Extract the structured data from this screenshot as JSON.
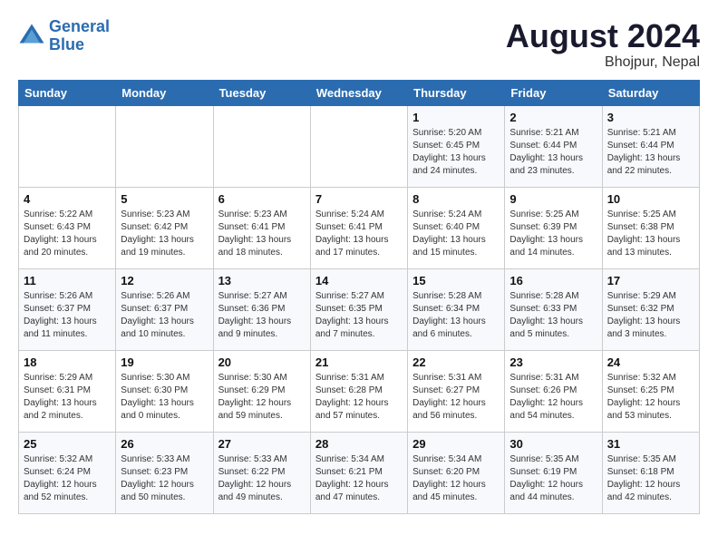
{
  "header": {
    "logo_line1": "General",
    "logo_line2": "Blue",
    "month_year": "August 2024",
    "location": "Bhojpur, Nepal"
  },
  "weekdays": [
    "Sunday",
    "Monday",
    "Tuesday",
    "Wednesday",
    "Thursday",
    "Friday",
    "Saturday"
  ],
  "weeks": [
    [
      {
        "day": "",
        "info": ""
      },
      {
        "day": "",
        "info": ""
      },
      {
        "day": "",
        "info": ""
      },
      {
        "day": "",
        "info": ""
      },
      {
        "day": "1",
        "info": "Sunrise: 5:20 AM\nSunset: 6:45 PM\nDaylight: 13 hours\nand 24 minutes."
      },
      {
        "day": "2",
        "info": "Sunrise: 5:21 AM\nSunset: 6:44 PM\nDaylight: 13 hours\nand 23 minutes."
      },
      {
        "day": "3",
        "info": "Sunrise: 5:21 AM\nSunset: 6:44 PM\nDaylight: 13 hours\nand 22 minutes."
      }
    ],
    [
      {
        "day": "4",
        "info": "Sunrise: 5:22 AM\nSunset: 6:43 PM\nDaylight: 13 hours\nand 20 minutes."
      },
      {
        "day": "5",
        "info": "Sunrise: 5:23 AM\nSunset: 6:42 PM\nDaylight: 13 hours\nand 19 minutes."
      },
      {
        "day": "6",
        "info": "Sunrise: 5:23 AM\nSunset: 6:41 PM\nDaylight: 13 hours\nand 18 minutes."
      },
      {
        "day": "7",
        "info": "Sunrise: 5:24 AM\nSunset: 6:41 PM\nDaylight: 13 hours\nand 17 minutes."
      },
      {
        "day": "8",
        "info": "Sunrise: 5:24 AM\nSunset: 6:40 PM\nDaylight: 13 hours\nand 15 minutes."
      },
      {
        "day": "9",
        "info": "Sunrise: 5:25 AM\nSunset: 6:39 PM\nDaylight: 13 hours\nand 14 minutes."
      },
      {
        "day": "10",
        "info": "Sunrise: 5:25 AM\nSunset: 6:38 PM\nDaylight: 13 hours\nand 13 minutes."
      }
    ],
    [
      {
        "day": "11",
        "info": "Sunrise: 5:26 AM\nSunset: 6:37 PM\nDaylight: 13 hours\nand 11 minutes."
      },
      {
        "day": "12",
        "info": "Sunrise: 5:26 AM\nSunset: 6:37 PM\nDaylight: 13 hours\nand 10 minutes."
      },
      {
        "day": "13",
        "info": "Sunrise: 5:27 AM\nSunset: 6:36 PM\nDaylight: 13 hours\nand 9 minutes."
      },
      {
        "day": "14",
        "info": "Sunrise: 5:27 AM\nSunset: 6:35 PM\nDaylight: 13 hours\nand 7 minutes."
      },
      {
        "day": "15",
        "info": "Sunrise: 5:28 AM\nSunset: 6:34 PM\nDaylight: 13 hours\nand 6 minutes."
      },
      {
        "day": "16",
        "info": "Sunrise: 5:28 AM\nSunset: 6:33 PM\nDaylight: 13 hours\nand 5 minutes."
      },
      {
        "day": "17",
        "info": "Sunrise: 5:29 AM\nSunset: 6:32 PM\nDaylight: 13 hours\nand 3 minutes."
      }
    ],
    [
      {
        "day": "18",
        "info": "Sunrise: 5:29 AM\nSunset: 6:31 PM\nDaylight: 13 hours\nand 2 minutes."
      },
      {
        "day": "19",
        "info": "Sunrise: 5:30 AM\nSunset: 6:30 PM\nDaylight: 13 hours\nand 0 minutes."
      },
      {
        "day": "20",
        "info": "Sunrise: 5:30 AM\nSunset: 6:29 PM\nDaylight: 12 hours\nand 59 minutes."
      },
      {
        "day": "21",
        "info": "Sunrise: 5:31 AM\nSunset: 6:28 PM\nDaylight: 12 hours\nand 57 minutes."
      },
      {
        "day": "22",
        "info": "Sunrise: 5:31 AM\nSunset: 6:27 PM\nDaylight: 12 hours\nand 56 minutes."
      },
      {
        "day": "23",
        "info": "Sunrise: 5:31 AM\nSunset: 6:26 PM\nDaylight: 12 hours\nand 54 minutes."
      },
      {
        "day": "24",
        "info": "Sunrise: 5:32 AM\nSunset: 6:25 PM\nDaylight: 12 hours\nand 53 minutes."
      }
    ],
    [
      {
        "day": "25",
        "info": "Sunrise: 5:32 AM\nSunset: 6:24 PM\nDaylight: 12 hours\nand 52 minutes."
      },
      {
        "day": "26",
        "info": "Sunrise: 5:33 AM\nSunset: 6:23 PM\nDaylight: 12 hours\nand 50 minutes."
      },
      {
        "day": "27",
        "info": "Sunrise: 5:33 AM\nSunset: 6:22 PM\nDaylight: 12 hours\nand 49 minutes."
      },
      {
        "day": "28",
        "info": "Sunrise: 5:34 AM\nSunset: 6:21 PM\nDaylight: 12 hours\nand 47 minutes."
      },
      {
        "day": "29",
        "info": "Sunrise: 5:34 AM\nSunset: 6:20 PM\nDaylight: 12 hours\nand 45 minutes."
      },
      {
        "day": "30",
        "info": "Sunrise: 5:35 AM\nSunset: 6:19 PM\nDaylight: 12 hours\nand 44 minutes."
      },
      {
        "day": "31",
        "info": "Sunrise: 5:35 AM\nSunset: 6:18 PM\nDaylight: 12 hours\nand 42 minutes."
      }
    ]
  ]
}
